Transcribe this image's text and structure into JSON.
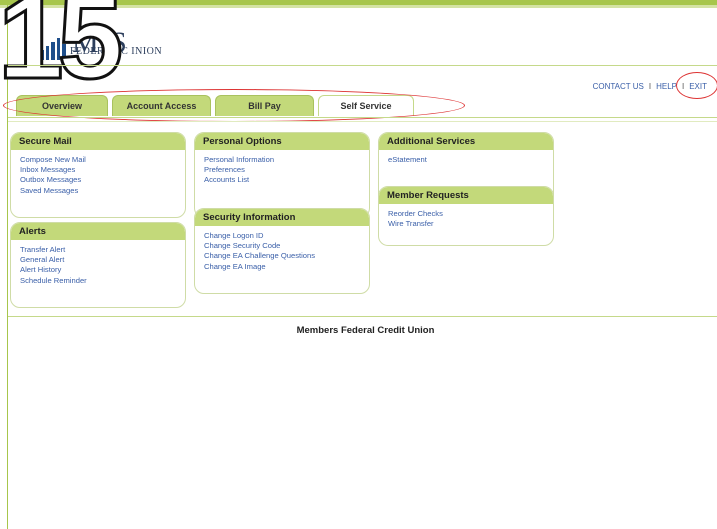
{
  "logo": {
    "big_text": "M    S",
    "small_text": "FEDERAL C        INION"
  },
  "overlay_number": "15",
  "top_links": {
    "contact": "CONTACT US",
    "sep1": "I",
    "help": "HELP",
    "sep2": "I",
    "exit": "EXIT"
  },
  "tabs": [
    {
      "label": "Overview"
    },
    {
      "label": "Account Access"
    },
    {
      "label": "Bill Pay"
    },
    {
      "label": "Self Service"
    }
  ],
  "panels": {
    "secure_mail": {
      "title": "Secure Mail",
      "items": [
        "Compose New Mail",
        "Inbox Messages",
        "Outbox Messages",
        "Saved Messages"
      ]
    },
    "alerts": {
      "title": "Alerts",
      "items": [
        "Transfer Alert",
        "General Alert",
        "Alert History",
        "Schedule Reminder"
      ]
    },
    "personal_options": {
      "title": "Personal Options",
      "items": [
        "Personal Information",
        "Preferences",
        "Accounts List"
      ]
    },
    "security_information": {
      "title": "Security Information",
      "items": [
        "Change Logon ID",
        "Change Security Code",
        "Change EA Challenge Questions",
        "Change EA Image"
      ]
    },
    "additional_services": {
      "title": "Additional Services",
      "items": [
        "eStatement"
      ]
    },
    "member_requests": {
      "title": "Member Requests",
      "items": [
        "Reorder Checks",
        "Wire Transfer"
      ]
    }
  },
  "footer": "Members Federal Credit Union",
  "colors": {
    "accent_green": "#c3d97a",
    "link_blue": "#3a5fa8",
    "annotation_red": "#d33"
  }
}
